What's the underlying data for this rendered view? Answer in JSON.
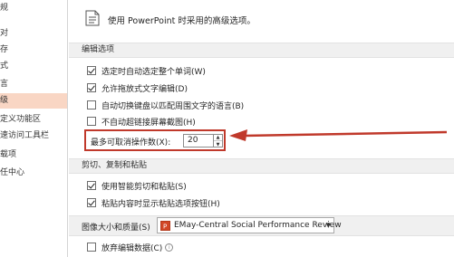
{
  "nav": {
    "items": [
      {
        "label": "规"
      },
      {
        "label": "对"
      },
      {
        "label": "存"
      },
      {
        "label": "式"
      },
      {
        "label": "言"
      },
      {
        "label": "级"
      },
      {
        "label": "定义功能区"
      },
      {
        "label": "速访问工具栏"
      },
      {
        "label": "载项"
      },
      {
        "label": "任中心"
      }
    ],
    "selected_index": 5
  },
  "header": {
    "text": "使用 PowerPoint 时采用的高级选项。",
    "icon": "document-icon"
  },
  "sections": {
    "editing": "编辑选项",
    "clipboard": "剪切、复制和粘贴",
    "image": "图像大小和质量(S)"
  },
  "editing_options": [
    {
      "label": "选定时自动选定整个单词(W)",
      "checked": true
    },
    {
      "label": "允许拖放式文字编辑(D)",
      "checked": true
    },
    {
      "label": "自动切换键盘以匹配周围文字的语言(B)",
      "checked": false
    },
    {
      "label": "不自动超链接屏幕截图(H)",
      "checked": false
    }
  ],
  "undo": {
    "label": "最多可取消操作数(X):",
    "value": "20"
  },
  "clipboard_options": [
    {
      "label": "使用智能剪切和粘贴(S)",
      "checked": true
    },
    {
      "label": "粘贴内容时显示粘贴选项按钮(H)",
      "checked": true
    }
  ],
  "image_quality": {
    "combo_value": "EMay-Central Social Performance Review",
    "discard_label": "放弃编辑数据(C)",
    "discard_checked": false
  },
  "colors": {
    "accent_red": "#c0392b",
    "nav_selected": "#f9d6c4"
  }
}
